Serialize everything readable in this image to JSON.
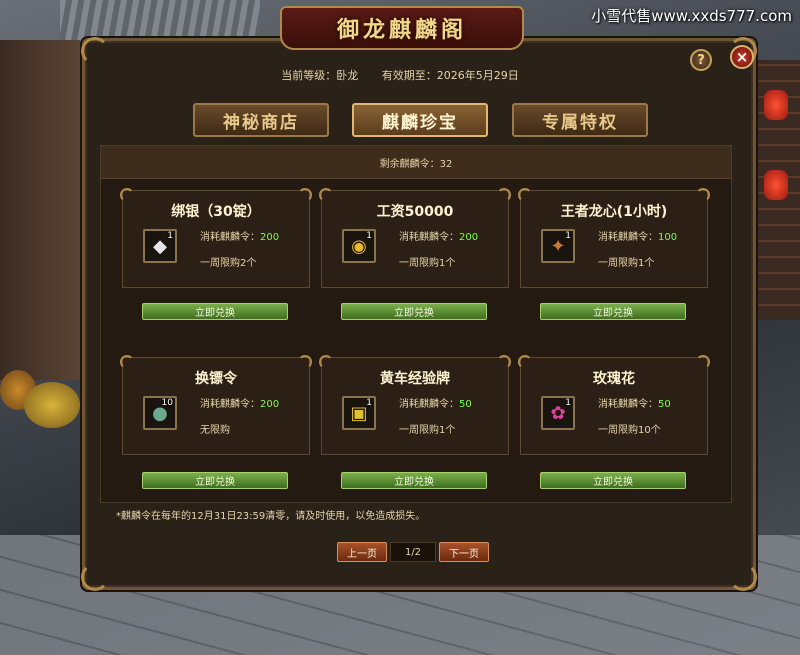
{
  "watermark": "小雪代售www.xxds777.com",
  "title": "御龙麒麟阁",
  "header": {
    "level": "当前等级：卧龙",
    "valid_until": "有效期至：2026年5月29日"
  },
  "help_label": "?",
  "close_label": "×",
  "tabs": [
    {
      "label": "神秘商店",
      "active": false
    },
    {
      "label": "麒麟珍宝",
      "active": true
    },
    {
      "label": "专属特权",
      "active": false
    }
  ],
  "remaining": "剩余麒麟令：32",
  "cost_label": "消耗麒麟令：",
  "exchange_label": "立即兑换",
  "items": [
    {
      "name": "绑银（30锭）",
      "icon": "silver-ingot-icon",
      "glyph": "◆",
      "qty": "1",
      "cost": "200",
      "limit": "一周限购2个"
    },
    {
      "name": "工资50000",
      "icon": "gold-coins-icon",
      "glyph": "◉",
      "qty": "1",
      "cost": "200",
      "limit": "一周限购1个"
    },
    {
      "name": "王者龙心(1小时)",
      "icon": "dragon-heart-icon",
      "glyph": "✦",
      "qty": "1",
      "cost": "100",
      "limit": "一周限购1个"
    },
    {
      "name": "换镖令",
      "icon": "escort-token-icon",
      "glyph": "●",
      "qty": "10",
      "cost": "200",
      "limit": "无限购"
    },
    {
      "name": "黄车经验牌",
      "icon": "cart-exp-plaque-icon",
      "glyph": "▣",
      "qty": "1",
      "cost": "50",
      "limit": "一周限购1个"
    },
    {
      "name": "玫瑰花",
      "icon": "rose-icon",
      "glyph": "✿",
      "qty": "1",
      "cost": "50",
      "limit": "一周限购10个"
    }
  ],
  "note": "*麒麟令在每年的12月31日23:59清零，请及时使用，以免造成损失。",
  "pager": {
    "prev": "上一页",
    "page": "1/2",
    "next": "下一页"
  }
}
